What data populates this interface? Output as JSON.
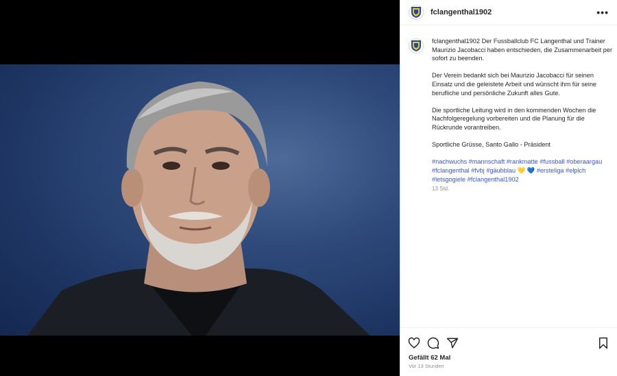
{
  "post": {
    "username": "fclangenthal1902",
    "more_label": "•••",
    "caption_username": "fclangenthal1902",
    "caption_p1": "Der Fussballclub FC Langenthal und Trainer Maurizio Jacobacci haben entschieden, die Zusammenarbeit per sofort zu beenden.",
    "caption_p2": "Der Verein bedankt sich bei Maurizio Jacobacci für seinen Einsatz und die geleistete Arbeit und wünscht ihm für seine berufliche und persönliche Zukunft alles Gute.",
    "caption_p3": "Die sportliche Leitung wird in den kommenden Wochen die Nachfolgeregelung vorbereiten und die Planung für die Rückrunde vorantreiben.",
    "caption_p4": "Sportliche Grüsse, Santo Gallo - Präsident",
    "tags": [
      "#nachwuchs",
      "#mannschaft",
      "#rankmatte",
      "#fussball",
      "#oberaargau",
      "#fclangenthal",
      "#fvbj",
      "#gäubblau",
      "#ersteliga",
      "#elplch",
      "#letsgogiele",
      "#fclangenthal1902"
    ],
    "tag_emoji": "💛 💙",
    "caption_time": "13 Std.",
    "likes": "Gefällt 62 Mal",
    "posted_ago": "Vor 13 Stunden"
  },
  "colors": {
    "link": "#3b57d0",
    "text": "#262626",
    "muted": "#8e8e8e",
    "photo_bg": "#1e3563"
  },
  "icons": [
    "heart-icon",
    "comment-icon",
    "share-icon",
    "bookmark-icon",
    "more-icon"
  ]
}
